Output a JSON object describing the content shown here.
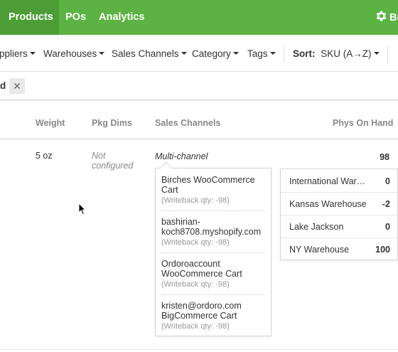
{
  "nav": {
    "tabs": [
      {
        "label": "Products",
        "active": true
      },
      {
        "label": "POs",
        "active": false
      },
      {
        "label": "Analytics",
        "active": false
      }
    ],
    "settings_label": "Bu",
    "settings_icon": "gear-icon",
    "bg_color": "#5cb343",
    "active_bg_color": "#4d9d37"
  },
  "filters": {
    "suppliers": "ppliers",
    "warehouses": "Warehouses",
    "sales_channels": "Sales Channels",
    "category": "Category",
    "tags": "Tags",
    "sort_label": "Sort:",
    "sort_value": "SKU (A→Z)"
  },
  "active_tag": {
    "text": "d",
    "close": "✕"
  },
  "table": {
    "headers": {
      "weight": "Weight",
      "pkg_dims": "Pkg Dims",
      "sales_channels": "Sales Channels",
      "phys_on_hand": "Phys On Hand"
    },
    "row": {
      "weight": "5 oz",
      "pkg_dims": "Not configured",
      "sales_channels": "Multi-channel",
      "phys_on_hand": "98"
    }
  },
  "channels": [
    {
      "name": "Birches WooCommerce Cart",
      "writeback": "(Writeback qty: -98)"
    },
    {
      "name": "bashirian-koch8708.myshopify.com",
      "writeback": "(Writeback qty: -98)"
    },
    {
      "name": "Ordoroaccount WooCommerce Cart",
      "writeback": "(Writeback qty: -98)"
    },
    {
      "name": "kristen@ordoro.com BigCommerce Cart",
      "writeback": "(Writeback qty: -98)"
    }
  ],
  "warehouses": [
    {
      "name": "International Wareh…",
      "qty": "0"
    },
    {
      "name": "Kansas Warehouse",
      "qty": "-2"
    },
    {
      "name": "Lake Jackson",
      "qty": "0"
    },
    {
      "name": "NY Warehouse",
      "qty": "100"
    }
  ]
}
